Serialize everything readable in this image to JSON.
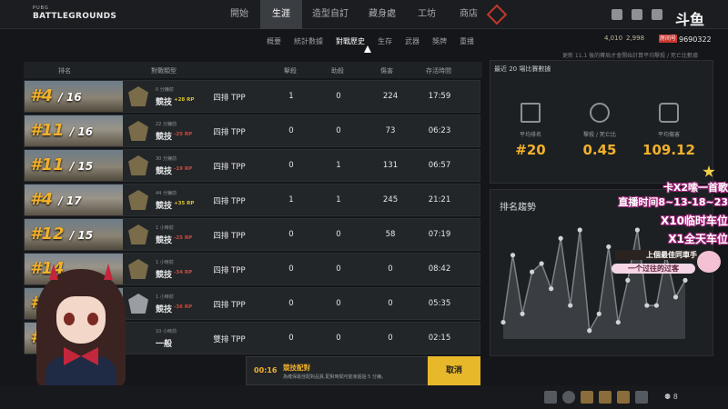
{
  "logo": {
    "small": "PUBG",
    "big": "BATTLEGROUNDS"
  },
  "nav": {
    "tabs": [
      "開始",
      "生涯",
      "造型自訂",
      "藏身處",
      "工坊",
      "商店"
    ],
    "active": 1
  },
  "header": {
    "currency_1": "4,010",
    "currency_2": "2,998",
    "room_label": "房间号",
    "room_number": "9690322",
    "stream_brand": "斗鱼",
    "notice": "更新 11.1 後的賽局才會開始計算平均擊殺 / 死亡比數據"
  },
  "subnav": {
    "tabs": [
      "概要",
      "統計數據",
      "對戰歷史",
      "生存",
      "武器",
      "獎牌",
      "重播"
    ],
    "active": 2
  },
  "table": {
    "headers": [
      "排名",
      "對戰類型",
      "擊殺",
      "助殺",
      "傷害",
      "存活時間"
    ],
    "rows": [
      {
        "rank": "#4",
        "total": "/ 16",
        "time": "0 分鐘前",
        "mode": "競技",
        "rp": "+28 RP",
        "rp_dir": "up",
        "type": "四排 TPP",
        "kills": "1",
        "assists": "0",
        "damage": "224",
        "survival": "17:59",
        "medal": "gold"
      },
      {
        "rank": "#11",
        "total": "/ 16",
        "time": "22 分鐘前",
        "mode": "競技",
        "rp": "-25 RP",
        "rp_dir": "down",
        "type": "四排 TPP",
        "kills": "0",
        "assists": "0",
        "damage": "73",
        "survival": "06:23",
        "medal": "gold"
      },
      {
        "rank": "#11",
        "total": "/ 15",
        "time": "30 分鐘前",
        "mode": "競技",
        "rp": "-19 RP",
        "rp_dir": "down",
        "type": "四排 TPP",
        "kills": "0",
        "assists": "1",
        "damage": "131",
        "survival": "06:57",
        "medal": "gold"
      },
      {
        "rank": "#4",
        "total": "/ 17",
        "time": "44 分鐘前",
        "mode": "競技",
        "rp": "+35 RP",
        "rp_dir": "up",
        "type": "四排 TPP",
        "kills": "1",
        "assists": "1",
        "damage": "245",
        "survival": "21:21",
        "medal": "gold"
      },
      {
        "rank": "#12",
        "total": "/ 15",
        "time": "1 小時前",
        "mode": "競技",
        "rp": "-25 RP",
        "rp_dir": "down",
        "type": "四排 TPP",
        "kills": "0",
        "assists": "0",
        "damage": "58",
        "survival": "07:19",
        "medal": "gold"
      },
      {
        "rank": "#14",
        "total": "",
        "time": "1 小時前",
        "mode": "競技",
        "rp": "-34 RP",
        "rp_dir": "down",
        "type": "四排 TPP",
        "kills": "0",
        "assists": "0",
        "damage": "0",
        "survival": "08:42",
        "medal": "gold"
      },
      {
        "rank": "#",
        "total": "",
        "time": "1 小時前",
        "mode": "競技",
        "rp": "-36 RP",
        "rp_dir": "down",
        "type": "四排 TPP",
        "kills": "0",
        "assists": "0",
        "damage": "0",
        "survival": "05:35",
        "medal": "silver"
      },
      {
        "rank": "#1",
        "total": "",
        "time": "10 小時前",
        "mode": "一般",
        "rp": "",
        "rp_dir": "",
        "type": "雙排 TPP",
        "kills": "0",
        "assists": "0",
        "damage": "0",
        "survival": "02:15",
        "medal": "none"
      }
    ]
  },
  "stats": {
    "title": "最近 20 場比賽數據",
    "items": [
      {
        "label": "平均排名",
        "value": "#20",
        "icon": "podium-icon"
      },
      {
        "label": "擊殺 / 死亡比",
        "value": "0.45",
        "icon": "crosshair-icon"
      },
      {
        "label": "平均傷害",
        "value": "109.12",
        "icon": "bullet-icon"
      }
    ]
  },
  "trend": {
    "title": "排名趨勢"
  },
  "chart_data": {
    "type": "line",
    "title": "排名趨勢",
    "xlabel": "",
    "ylabel": "",
    "x": [
      1,
      2,
      3,
      4,
      5,
      6,
      7,
      8,
      9,
      10,
      11,
      12,
      13,
      14,
      15,
      16,
      17,
      18,
      19,
      20
    ],
    "values": [
      12,
      4,
      11,
      6,
      5,
      8,
      2,
      10,
      1,
      13,
      11,
      3,
      12,
      7,
      1,
      10,
      10,
      4,
      9,
      7
    ],
    "ylim": [
      1,
      14
    ],
    "grid": false,
    "color": "#7d8186"
  },
  "overlay": {
    "line1": "卡X2嗦一首歌",
    "line2": "直播时间8~13-18~23",
    "line3": "X10临时车位",
    "line4": "X1全天车位",
    "line5": "上個最佳同車手",
    "line6": "一个过往的过客"
  },
  "queue": {
    "time": "00:16",
    "title": "競技配對",
    "desc": "為確保最佳配對品質,配對時間可能會超過 5 分鐘。",
    "cancel": "取消"
  },
  "bottom": {
    "count": "8"
  },
  "colors": {
    "accent": "#f2b12a",
    "bg": "#141619",
    "panel": "#1d2023",
    "cancel": "#e8b82b"
  }
}
